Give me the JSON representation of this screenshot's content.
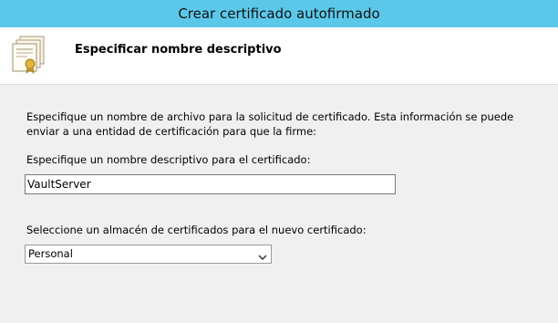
{
  "window": {
    "title": "Crear certificado autofirmado"
  },
  "header": {
    "heading": "Especificar nombre descriptivo",
    "icon": "certificate-icon"
  },
  "content": {
    "description": "Especifique un nombre de archivo para la solicitud de certificado. Esta información se puede enviar a una entidad de certificación para que la firme:",
    "name_label": "Especifique un nombre descriptivo para el certificado:",
    "name_value": "VaultServer",
    "store_label": "Seleccione un almacén de certificados para el nuevo certificado:",
    "store_value": "Personal",
    "store_icon": "chevron-down-icon"
  },
  "colors": {
    "titlebar": "#5bc8ea",
    "background": "#f0f0f0",
    "header": "#ffffff"
  }
}
